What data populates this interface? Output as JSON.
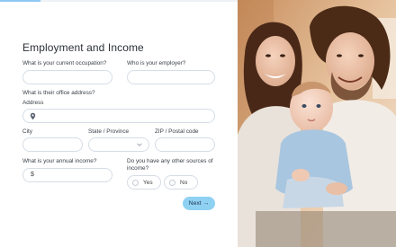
{
  "form": {
    "title": "Employment and Income",
    "progress_fraction": 0.17,
    "occupation": {
      "label": "What is your current occupation?",
      "value": ""
    },
    "employer": {
      "label": "Who is your employer?",
      "value": ""
    },
    "office_address_heading": "What is their office address?",
    "address": {
      "label": "Address",
      "value": "",
      "icon": "location-pin-icon"
    },
    "city": {
      "label": "City",
      "value": ""
    },
    "state": {
      "label": "State / Province",
      "value": "",
      "icon": "chevron-down-icon"
    },
    "zip": {
      "label": "ZIP / Postal code",
      "value": ""
    },
    "income": {
      "label": "What is your annual income?",
      "prefix": "$",
      "value": ""
    },
    "other_sources": {
      "label_line1": "Do you have any other sources of",
      "label_line2": "income?",
      "options": [
        "Yes",
        "No"
      ]
    },
    "next_label": "Next →"
  },
  "colors": {
    "accent": "#8fd1f3",
    "progress": "#8ec9f2",
    "field_border": "#d6dde6"
  },
  "photo": {
    "description_icon": "family-photo"
  }
}
